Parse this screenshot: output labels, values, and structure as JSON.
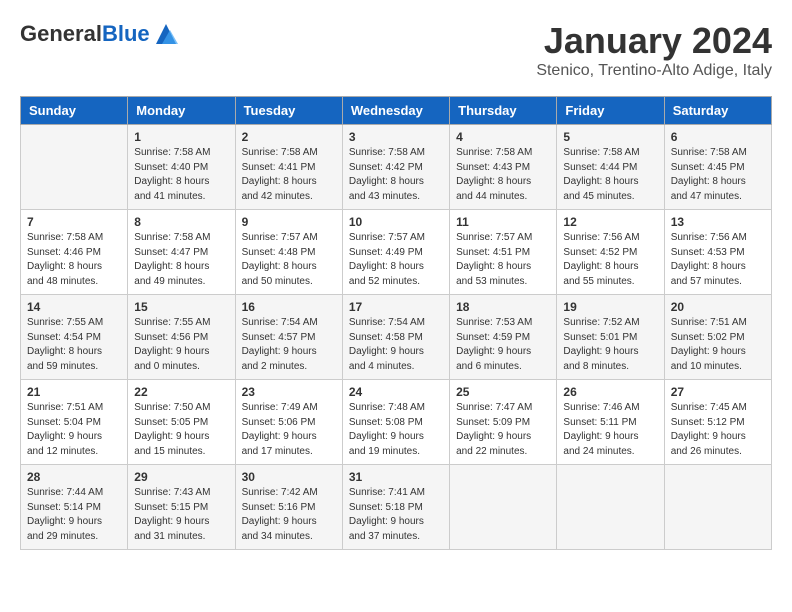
{
  "header": {
    "logo_general": "General",
    "logo_blue": "Blue",
    "month": "January 2024",
    "location": "Stenico, Trentino-Alto Adige, Italy"
  },
  "days_of_week": [
    "Sunday",
    "Monday",
    "Tuesday",
    "Wednesday",
    "Thursday",
    "Friday",
    "Saturday"
  ],
  "weeks": [
    [
      {
        "day": "",
        "sunrise": "",
        "sunset": "",
        "daylight": ""
      },
      {
        "day": "1",
        "sunrise": "7:58 AM",
        "sunset": "4:40 PM",
        "daylight": "8 hours and 41 minutes."
      },
      {
        "day": "2",
        "sunrise": "7:58 AM",
        "sunset": "4:41 PM",
        "daylight": "8 hours and 42 minutes."
      },
      {
        "day": "3",
        "sunrise": "7:58 AM",
        "sunset": "4:42 PM",
        "daylight": "8 hours and 43 minutes."
      },
      {
        "day": "4",
        "sunrise": "7:58 AM",
        "sunset": "4:43 PM",
        "daylight": "8 hours and 44 minutes."
      },
      {
        "day": "5",
        "sunrise": "7:58 AM",
        "sunset": "4:44 PM",
        "daylight": "8 hours and 45 minutes."
      },
      {
        "day": "6",
        "sunrise": "7:58 AM",
        "sunset": "4:45 PM",
        "daylight": "8 hours and 47 minutes."
      }
    ],
    [
      {
        "day": "7",
        "sunrise": "7:58 AM",
        "sunset": "4:46 PM",
        "daylight": "8 hours and 48 minutes."
      },
      {
        "day": "8",
        "sunrise": "7:58 AM",
        "sunset": "4:47 PM",
        "daylight": "8 hours and 49 minutes."
      },
      {
        "day": "9",
        "sunrise": "7:57 AM",
        "sunset": "4:48 PM",
        "daylight": "8 hours and 50 minutes."
      },
      {
        "day": "10",
        "sunrise": "7:57 AM",
        "sunset": "4:49 PM",
        "daylight": "8 hours and 52 minutes."
      },
      {
        "day": "11",
        "sunrise": "7:57 AM",
        "sunset": "4:51 PM",
        "daylight": "8 hours and 53 minutes."
      },
      {
        "day": "12",
        "sunrise": "7:56 AM",
        "sunset": "4:52 PM",
        "daylight": "8 hours and 55 minutes."
      },
      {
        "day": "13",
        "sunrise": "7:56 AM",
        "sunset": "4:53 PM",
        "daylight": "8 hours and 57 minutes."
      }
    ],
    [
      {
        "day": "14",
        "sunrise": "7:55 AM",
        "sunset": "4:54 PM",
        "daylight": "8 hours and 59 minutes."
      },
      {
        "day": "15",
        "sunrise": "7:55 AM",
        "sunset": "4:56 PM",
        "daylight": "9 hours and 0 minutes."
      },
      {
        "day": "16",
        "sunrise": "7:54 AM",
        "sunset": "4:57 PM",
        "daylight": "9 hours and 2 minutes."
      },
      {
        "day": "17",
        "sunrise": "7:54 AM",
        "sunset": "4:58 PM",
        "daylight": "9 hours and 4 minutes."
      },
      {
        "day": "18",
        "sunrise": "7:53 AM",
        "sunset": "4:59 PM",
        "daylight": "9 hours and 6 minutes."
      },
      {
        "day": "19",
        "sunrise": "7:52 AM",
        "sunset": "5:01 PM",
        "daylight": "9 hours and 8 minutes."
      },
      {
        "day": "20",
        "sunrise": "7:51 AM",
        "sunset": "5:02 PM",
        "daylight": "9 hours and 10 minutes."
      }
    ],
    [
      {
        "day": "21",
        "sunrise": "7:51 AM",
        "sunset": "5:04 PM",
        "daylight": "9 hours and 12 minutes."
      },
      {
        "day": "22",
        "sunrise": "7:50 AM",
        "sunset": "5:05 PM",
        "daylight": "9 hours and 15 minutes."
      },
      {
        "day": "23",
        "sunrise": "7:49 AM",
        "sunset": "5:06 PM",
        "daylight": "9 hours and 17 minutes."
      },
      {
        "day": "24",
        "sunrise": "7:48 AM",
        "sunset": "5:08 PM",
        "daylight": "9 hours and 19 minutes."
      },
      {
        "day": "25",
        "sunrise": "7:47 AM",
        "sunset": "5:09 PM",
        "daylight": "9 hours and 22 minutes."
      },
      {
        "day": "26",
        "sunrise": "7:46 AM",
        "sunset": "5:11 PM",
        "daylight": "9 hours and 24 minutes."
      },
      {
        "day": "27",
        "sunrise": "7:45 AM",
        "sunset": "5:12 PM",
        "daylight": "9 hours and 26 minutes."
      }
    ],
    [
      {
        "day": "28",
        "sunrise": "7:44 AM",
        "sunset": "5:14 PM",
        "daylight": "9 hours and 29 minutes."
      },
      {
        "day": "29",
        "sunrise": "7:43 AM",
        "sunset": "5:15 PM",
        "daylight": "9 hours and 31 minutes."
      },
      {
        "day": "30",
        "sunrise": "7:42 AM",
        "sunset": "5:16 PM",
        "daylight": "9 hours and 34 minutes."
      },
      {
        "day": "31",
        "sunrise": "7:41 AM",
        "sunset": "5:18 PM",
        "daylight": "9 hours and 37 minutes."
      },
      {
        "day": "",
        "sunrise": "",
        "sunset": "",
        "daylight": ""
      },
      {
        "day": "",
        "sunrise": "",
        "sunset": "",
        "daylight": ""
      },
      {
        "day": "",
        "sunrise": "",
        "sunset": "",
        "daylight": ""
      }
    ]
  ]
}
